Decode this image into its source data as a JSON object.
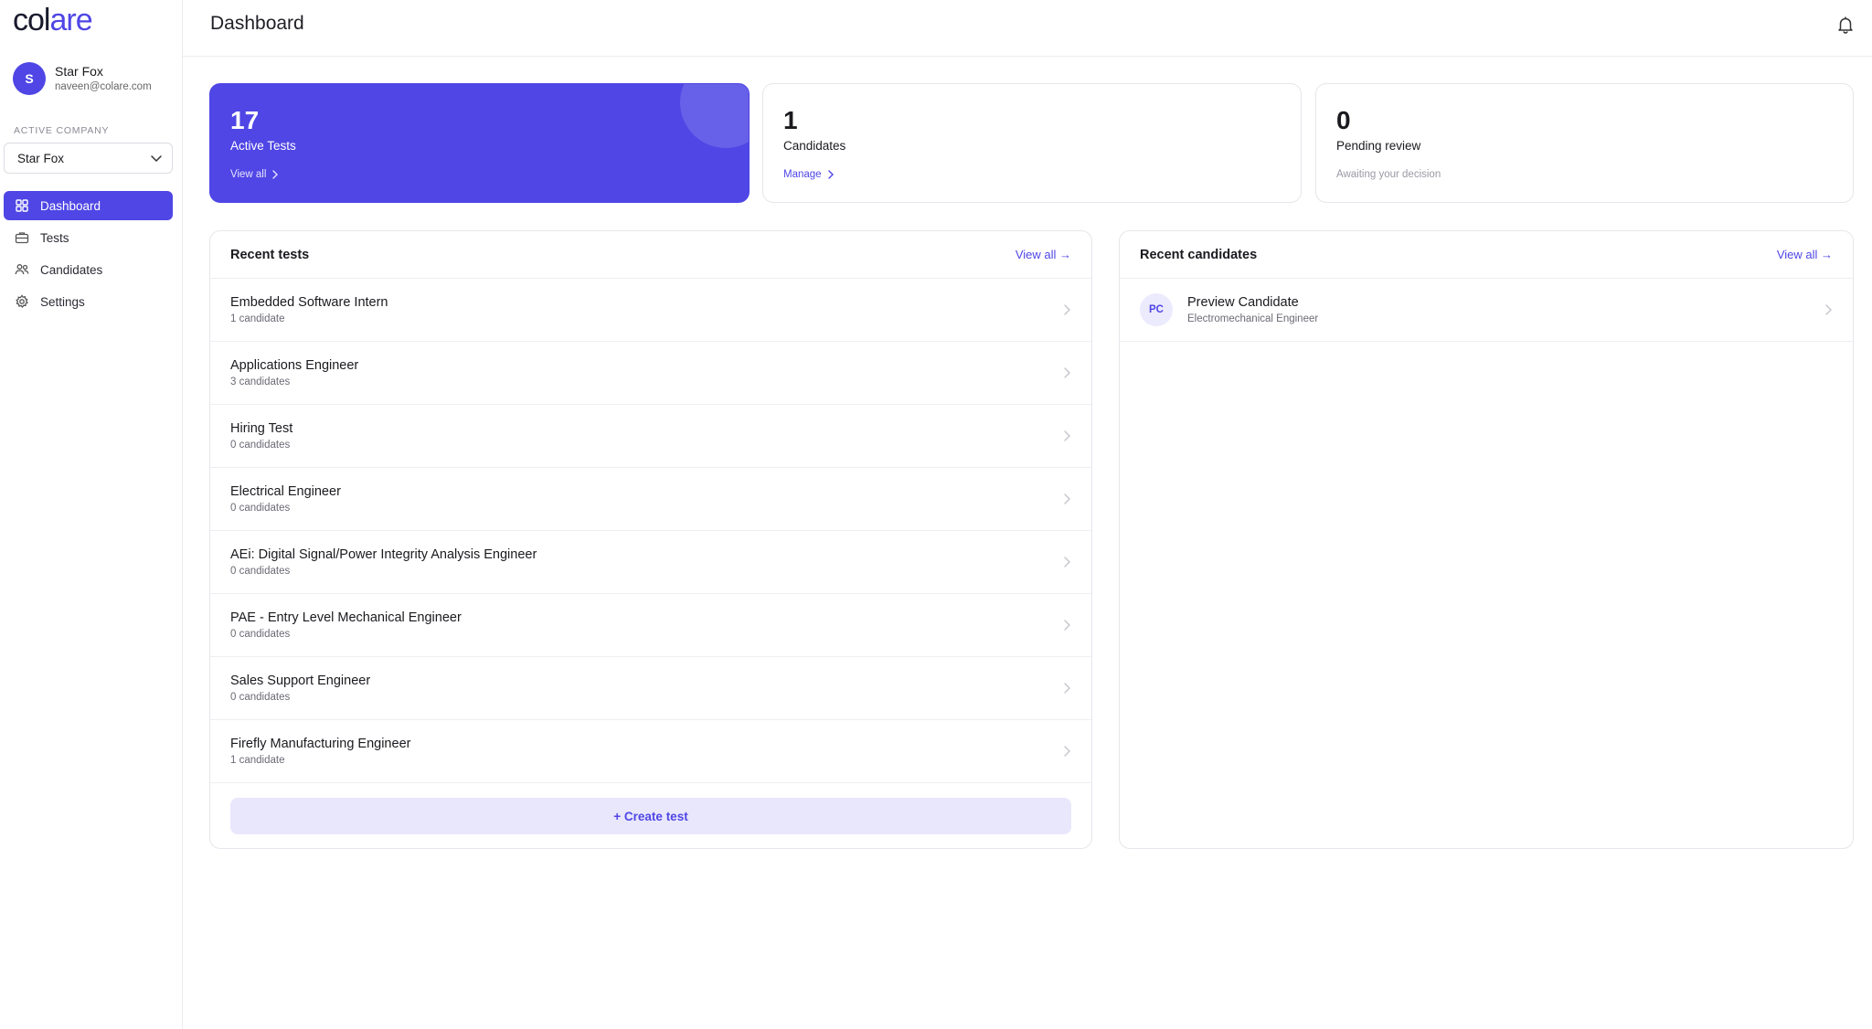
{
  "brand": {
    "logo_part1": "col",
    "logo_part2": "are",
    "accent": "#4f46e5"
  },
  "user": {
    "initial": "S",
    "name": "Star Fox",
    "email": "naveen@colare.com"
  },
  "company": {
    "label": "ACTIVE COMPANY",
    "selected": "Star Fox"
  },
  "nav": [
    {
      "label": "Dashboard",
      "icon": "grid-icon",
      "active": true
    },
    {
      "label": "Tests",
      "icon": "briefcase-icon",
      "active": false
    },
    {
      "label": "Candidates",
      "icon": "users-icon",
      "active": false
    },
    {
      "label": "Settings",
      "icon": "gear-icon",
      "active": false
    }
  ],
  "header": {
    "title": "Dashboard",
    "icon": "bell-icon"
  },
  "stats": [
    {
      "value": "17",
      "label": "Active Tests",
      "link": "View all"
    },
    {
      "value": "1",
      "label": "Candidates",
      "link": "Manage"
    },
    {
      "value": "0",
      "label": "Pending review",
      "note": "Awaiting your decision"
    }
  ],
  "recent_tests": {
    "title": "Recent tests",
    "view_all": "View all →",
    "items": [
      {
        "name": "Embedded Software Intern",
        "count": "1 candidate"
      },
      {
        "name": "Applications Engineer",
        "count": "3 candidates"
      },
      {
        "name": "Hiring Test",
        "count": "0 candidates"
      },
      {
        "name": "Electrical Engineer",
        "count": "0 candidates"
      },
      {
        "name": "AEi: Digital Signal/Power Integrity Analysis Engineer",
        "count": "0 candidates"
      },
      {
        "name": "PAE - Entry Level Mechanical Engineer",
        "count": "0 candidates"
      },
      {
        "name": "Sales Support Engineer",
        "count": "0 candidates"
      },
      {
        "name": "Firefly Manufacturing Engineer",
        "count": "1 candidate"
      }
    ],
    "create_label": "+ Create test"
  },
  "recent_candidates": {
    "title": "Recent candidates",
    "view_all": "View all →",
    "items": [
      {
        "initials": "PC",
        "name": "Preview Candidate",
        "role": "Electromechanical Engineer"
      }
    ]
  }
}
